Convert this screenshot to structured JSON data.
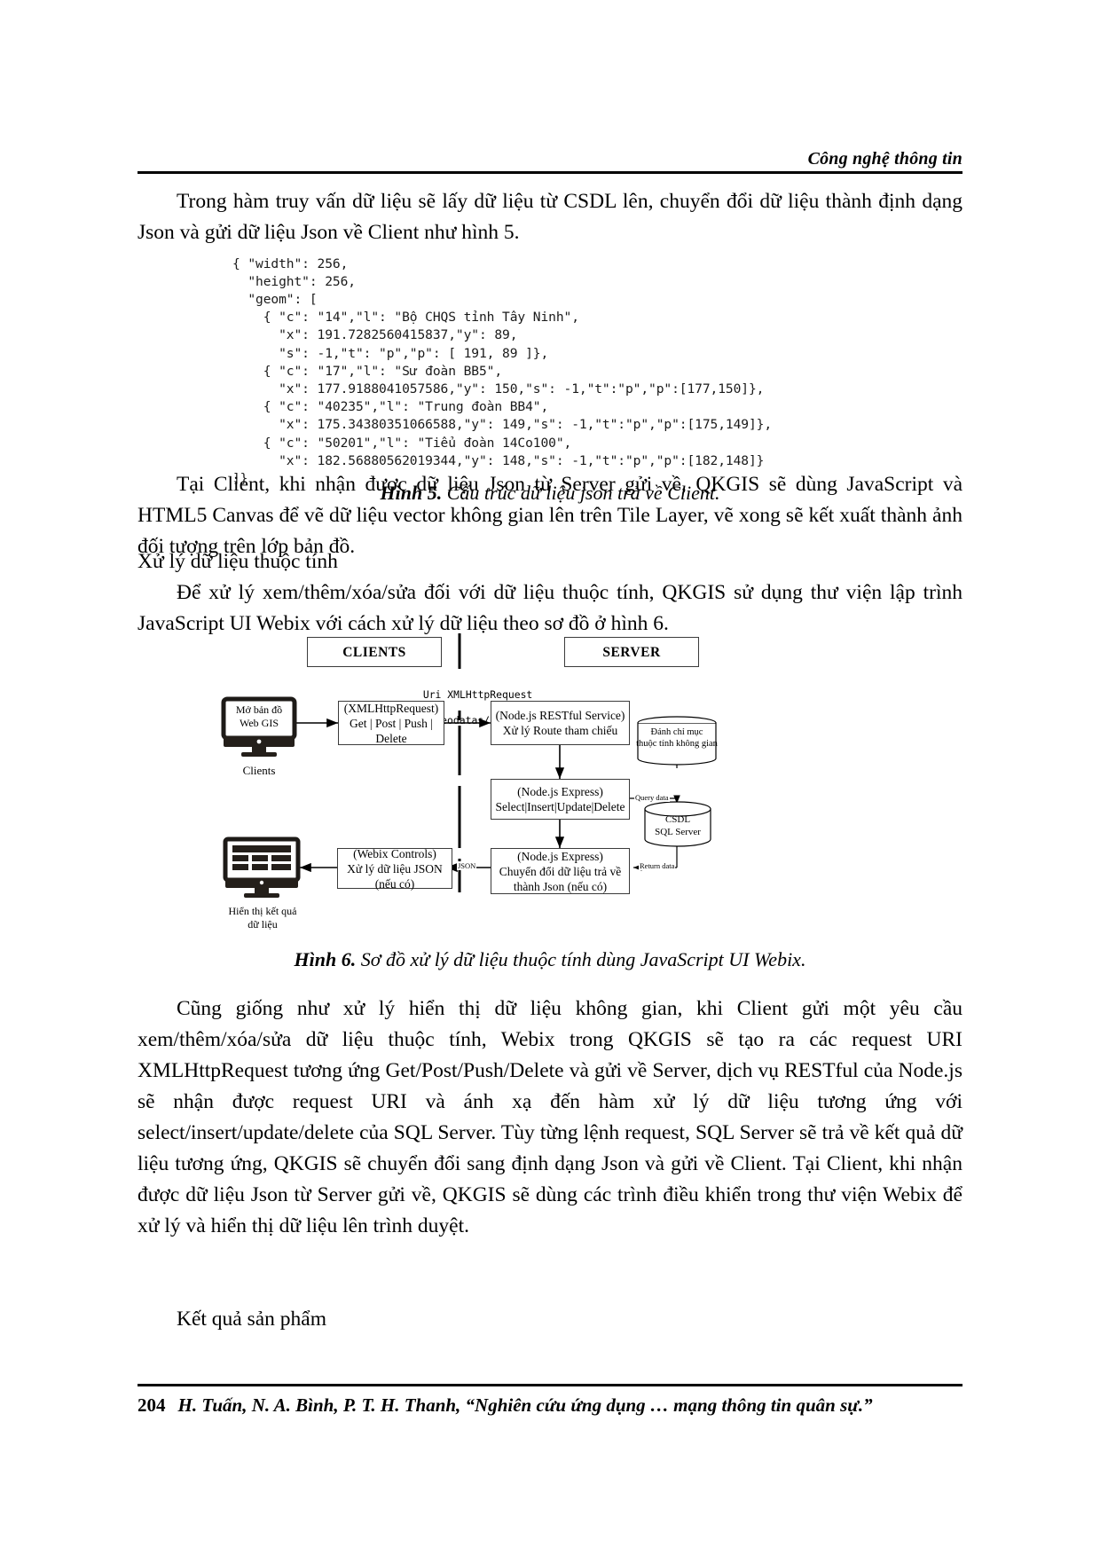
{
  "header": {
    "running_head": "Công nghệ thông tin"
  },
  "paragraphs": {
    "p1": "Trong hàm truy vấn dữ liệu sẽ lấy dữ liệu từ CSDL lên, chuyển đổi dữ liệu thành định dạng Json và gửi dữ liệu Json về Client như hình 5.",
    "p2": "Tại Client, khi nhận được dữ liệu Json từ Server gửi về, QKGIS sẽ dùng JavaScript và HTML5 Canvas để vẽ dữ liệu vector không gian lên trên Tile Layer, vẽ xong sẽ kết xuất thành ảnh đối tượng trên lớp bản đồ.",
    "p3": "Xử lý dữ liệu thuộc tính",
    "p4": "Để xử lý xem/thêm/xóa/sửa đối với dữ liệu thuộc tính, QKGIS sử dụng thư viện lập trình JavaScript UI Webix với cách xử lý dữ liệu theo sơ đồ ở hình 6.",
    "p5": "Cũng giống như xử lý hiển thị dữ liệu không gian, khi Client gửi một yêu cầu xem/thêm/xóa/sửa dữ liệu thuộc tính, Webix trong QKGIS sẽ tạo ra các request URI XMLHttpRequest tương ứng Get/Post/Push/Delete và gửi về Server, dịch vụ RESTful của Node.js sẽ nhận được request URI và ánh xạ đến hàm xử lý dữ liệu tương ứng với select/insert/update/delete của SQL Server. Tùy từng lệnh request, SQL Server sẽ trả về kết quả dữ liệu tương ứng, QKGIS sẽ chuyển đổi sang định dạng Json và gửi về Client. Tại Client, khi nhận được dữ liệu Json từ Server gửi về, QKGIS sẽ dùng các trình điều khiển trong thư viện Webix để xử lý và hiển thị dữ liệu lên trình duyệt.",
    "p6": "Kết quả sản phẩm"
  },
  "code_block": {
    "language": "json",
    "lines": [
      "{ \"width\": 256,",
      "  \"height\": 256,",
      "  \"geom\": [",
      "    { \"c\": \"14\",\"l\": \"Bộ CHQS tỉnh Tây Ninh\",",
      "      \"x\": 191.7282560415837,\"y\": 89,",
      "      \"s\": -1,\"t\": \"p\",\"p\": [ 191, 89 ]},",
      "    { \"c\": \"17\",\"l\": \"Sư đoàn BB5\",",
      "      \"x\": 177.9188041057586,\"y\": 150,\"s\": -1,\"t\":\"p\",\"p\":[177,150]},",
      "    { \"c\": \"40235\",\"l\": \"Trung đoàn BB4\",",
      "      \"x\": 175.34380351066588,\"y\": 149,\"s\": -1,\"t\":\"p\",\"p\":[175,149]},",
      "    { \"c\": \"50201\",\"l\": \"Tiểu đoàn 14Co100\",",
      "      \"x\": 182.56880562019344,\"y\": 148,\"s\": -1,\"t\":\"p\",\"p\":[182,148]}",
      "]}"
    ]
  },
  "captions": {
    "fig5_label": "Hình 5.",
    "fig5_text": " Cấu trúc dữ liệu json trả về Client.",
    "fig6_label": "Hình 6.",
    "fig6_text": " Sơ đồ xử lý dữ liệu thuộc tính dùng JavaScript UI Webix."
  },
  "figure6": {
    "header_clients": "CLIENTS",
    "header_server": "SERVER",
    "uri_line1": "Uri XMLHttpRequest",
    "uri_line2": "/rest/geodatas/:featureclass",
    "monitor_top_line1": "Mở bản đồ",
    "monitor_top_line2": "Web GIS",
    "monitor_top_caption": "Clients",
    "monitor_bottom_caption_line1": "Hiển thị kết quả",
    "monitor_bottom_caption_line2": "dữ liệu",
    "box_xhr_line1": "(XMLHttpRequest)",
    "box_xhr_line2": "Get | Post | Push | Delete",
    "box_rest_line1": "(Node.js RESTful Service)",
    "box_rest_line2": "Xử lý Route tham chiếu",
    "box_express1_line1": "(Node.js Express)",
    "box_express1_line2": "Select|Insert|Update|Delete",
    "box_express2_line1": "(Node.js Express)",
    "box_express2_line2": "Chuyển đổi dữ liệu trả về",
    "box_express2_line3": "thành Json (nếu có)",
    "box_webix_line1": "(Webix Controls)",
    "box_webix_line2": "Xử lý dữ liệu JSON (nếu có)",
    "index_line1": "Đánh chỉ mục",
    "index_line2": "thuộc tính không gian",
    "db_line1": "CSDL",
    "db_line2": "SQL Server",
    "edge_query": "Query data",
    "edge_return": "Return data",
    "edge_json": "JSON"
  },
  "footer": {
    "page_number": "204",
    "citation": "H. Tuấn, N. A. Bình, P. T. H. Thanh, “Nghiên cứu ứng dụng … mạng thông tin quân sự.”"
  }
}
